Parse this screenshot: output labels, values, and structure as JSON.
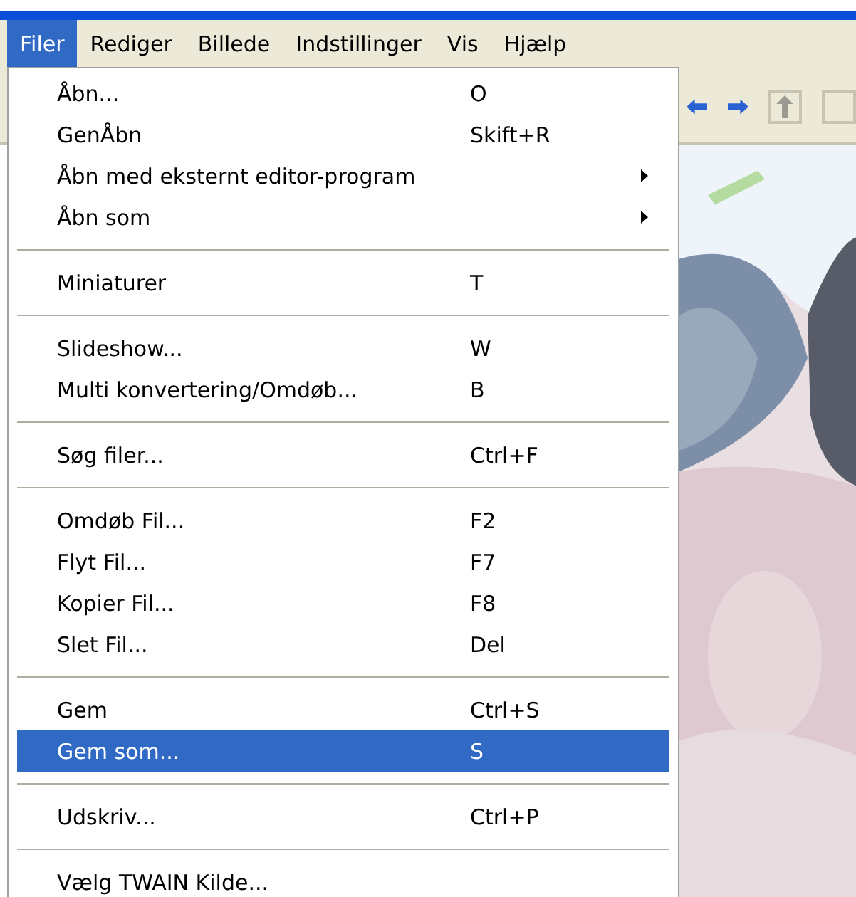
{
  "menubar": [
    {
      "label": "Filer",
      "selected": true
    },
    {
      "label": "Rediger",
      "selected": false
    },
    {
      "label": "Billede",
      "selected": false
    },
    {
      "label": "Indstillinger",
      "selected": false
    },
    {
      "label": "Vis",
      "selected": false
    },
    {
      "label": "Hjælp",
      "selected": false
    }
  ],
  "menu": [
    {
      "kind": "item",
      "label": "Åbn...",
      "shortcut": "O",
      "submenu": false,
      "selected": false
    },
    {
      "kind": "item",
      "label": "GenÅbn",
      "shortcut": "Skift+R",
      "submenu": false,
      "selected": false
    },
    {
      "kind": "item",
      "label": "Åbn med eksternt editor-program",
      "submenu": true,
      "selected": false
    },
    {
      "kind": "item",
      "label": "Åbn som",
      "submenu": true,
      "selected": false
    },
    {
      "kind": "separator"
    },
    {
      "kind": "item",
      "label": "Miniaturer",
      "shortcut": "T",
      "submenu": false,
      "selected": false
    },
    {
      "kind": "separator"
    },
    {
      "kind": "item",
      "label": "Slideshow...",
      "shortcut": "W",
      "submenu": false,
      "selected": false
    },
    {
      "kind": "item",
      "label": "Multi konvertering/Omdøb...",
      "shortcut": "B",
      "submenu": false,
      "selected": false
    },
    {
      "kind": "separator"
    },
    {
      "kind": "item",
      "label": "Søg filer...",
      "shortcut": "Ctrl+F",
      "submenu": false,
      "selected": false
    },
    {
      "kind": "separator"
    },
    {
      "kind": "item",
      "label": "Omdøb Fil...",
      "shortcut": "F2",
      "submenu": false,
      "selected": false
    },
    {
      "kind": "item",
      "label": "Flyt Fil...",
      "shortcut": "F7",
      "submenu": false,
      "selected": false
    },
    {
      "kind": "item",
      "label": "Kopier Fil...",
      "shortcut": "F8",
      "submenu": false,
      "selected": false
    },
    {
      "kind": "item",
      "label": "Slet Fil...",
      "shortcut": "Del",
      "submenu": false,
      "selected": false
    },
    {
      "kind": "separator"
    },
    {
      "kind": "item",
      "label": "Gem",
      "shortcut": "Ctrl+S",
      "submenu": false,
      "selected": false
    },
    {
      "kind": "item",
      "label": "Gem som...",
      "shortcut": "S",
      "submenu": false,
      "selected": true
    },
    {
      "kind": "separator"
    },
    {
      "kind": "item",
      "label": "Udskriv...",
      "shortcut": "Ctrl+P",
      "submenu": false,
      "selected": false
    },
    {
      "kind": "separator"
    },
    {
      "kind": "item",
      "label": "Vælg TWAIN Kilde...",
      "submenu": false,
      "selected": false
    }
  ]
}
